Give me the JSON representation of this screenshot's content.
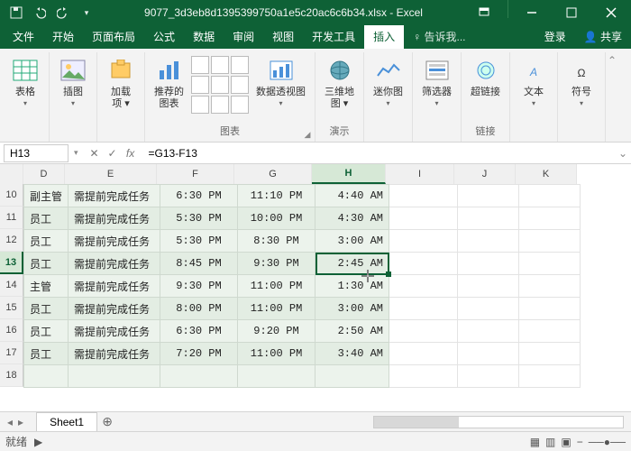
{
  "titlebar": {
    "filename": "9077_3d3eb8d1395399750a1e5c20ac6c6b34.xlsx - Excel"
  },
  "tabs": {
    "file": "文件",
    "home": "开始",
    "layout": "页面布局",
    "formula": "公式",
    "data": "数据",
    "review": "审阅",
    "view": "视图",
    "dev": "开发工具",
    "insert": "插入",
    "tell": "告诉我...",
    "login": "登录",
    "share": "共享"
  },
  "ribbon": {
    "tables": {
      "btn": "表格"
    },
    "illus": {
      "btn": "插图"
    },
    "addins": {
      "btn": "加载\n项 ▾"
    },
    "charts": {
      "recommended": "推荐的\n图表",
      "group": "图表"
    },
    "pivot": {
      "btn": "数据透视图",
      "group": "演示"
    },
    "map3d": {
      "btn": "三维地\n图 ▾"
    },
    "sparklines": {
      "btn": "迷你图"
    },
    "filters": {
      "btn": "筛选器"
    },
    "links": {
      "btn": "超链接",
      "group": "链接"
    },
    "text": {
      "btn": "文本"
    },
    "symbols": {
      "btn": "符号"
    }
  },
  "formula_bar": {
    "name": "H13",
    "fx": "fx",
    "value": "=G13-F13"
  },
  "columns": [
    "D",
    "E",
    "F",
    "G",
    "H",
    "I",
    "J",
    "K"
  ],
  "row_start": 10,
  "rows": [
    {
      "n": 10,
      "D": "副主管",
      "E": "需提前完成任务",
      "F": "6:30 PM",
      "G": "11:10 PM",
      "H": "4:40 AM"
    },
    {
      "n": 11,
      "D": "员工",
      "E": "需提前完成任务",
      "F": "5:30 PM",
      "G": "10:00 PM",
      "H": "4:30 AM"
    },
    {
      "n": 12,
      "D": "员工",
      "E": "需提前完成任务",
      "F": "5:30 PM",
      "G": "8:30 PM",
      "H": "3:00 AM"
    },
    {
      "n": 13,
      "D": "员工",
      "E": "需提前完成任务",
      "F": "8:45 PM",
      "G": "9:30 PM",
      "H": "2:45 AM"
    },
    {
      "n": 14,
      "D": "主管",
      "E": "需提前完成任务",
      "F": "9:30 PM",
      "G": "11:00 PM",
      "H": "1:30 AM"
    },
    {
      "n": 15,
      "D": "员工",
      "E": "需提前完成任务",
      "F": "8:00 PM",
      "G": "11:00 PM",
      "H": "3:00 AM"
    },
    {
      "n": 16,
      "D": "员工",
      "E": "需提前完成任务",
      "F": "6:30 PM",
      "G": "9:20 PM",
      "H": "2:50 AM"
    },
    {
      "n": 17,
      "D": "员工",
      "E": "需提前完成任务",
      "F": "7:20 PM",
      "G": "11:00 PM",
      "H": "3:40 AM"
    },
    {
      "n": 18,
      "D": "",
      "E": "",
      "F": "",
      "G": "",
      "H": ""
    }
  ],
  "active": {
    "col": "H",
    "row": 13
  },
  "sheet": {
    "tab": "Sheet1"
  },
  "status": {
    "ready": "就绪"
  }
}
